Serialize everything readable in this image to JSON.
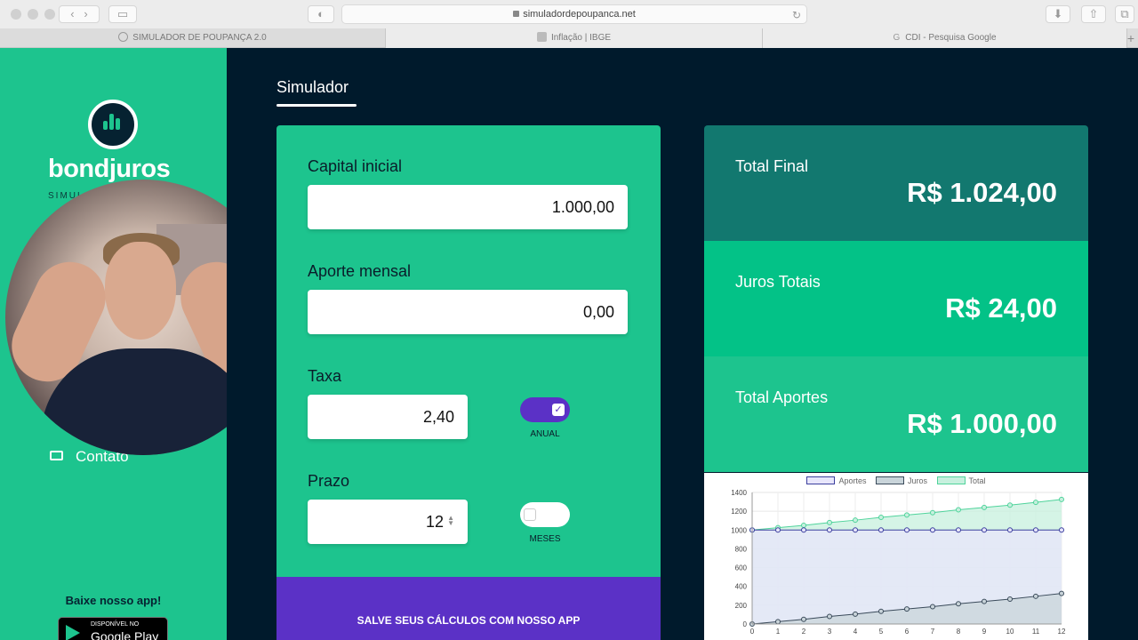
{
  "browser": {
    "url": "simuladordepoupanca.net",
    "tabs": [
      {
        "label": "SIMULADOR DE POUPANÇA 2.0"
      },
      {
        "label": "Inflação | IBGE"
      },
      {
        "label": "CDI - Pesquisa Google"
      }
    ]
  },
  "sidebar": {
    "brand": "bondjuros",
    "brand_sub": "SIMUL",
    "contact_label": "Contato",
    "app_promo": "Baixe nosso app!",
    "gplay_small": "DISPONÍVEL NO",
    "gplay_big": "Google Play"
  },
  "main": {
    "page_tab": "Simulador",
    "fields": {
      "capital": {
        "label": "Capital inicial",
        "value": "1.000,00"
      },
      "aporte": {
        "label": "Aporte mensal",
        "value": "0,00"
      },
      "taxa": {
        "label": "Taxa",
        "value": "2,40",
        "toggle_label": "ANUAL"
      },
      "prazo": {
        "label": "Prazo",
        "value": "12",
        "toggle_label": "MESES"
      }
    },
    "save_label": "SALVE SEUS CÁLCULOS COM NOSSO APP"
  },
  "results": {
    "total_final": {
      "label": "Total Final",
      "value": "R$ 1.024,00"
    },
    "juros_totais": {
      "label": "Juros Totais",
      "value": "R$ 24,00"
    },
    "total_aportes": {
      "label": "Total Aportes",
      "value": "R$ 1.000,00"
    }
  },
  "chart_data": {
    "type": "area",
    "x": [
      0,
      1,
      2,
      3,
      4,
      5,
      6,
      7,
      8,
      9,
      10,
      11,
      12
    ],
    "ylim": [
      0,
      1400
    ],
    "yticks": [
      0,
      200,
      400,
      600,
      800,
      1000,
      1200,
      1400
    ],
    "grid": true,
    "legend_position": "top",
    "series": [
      {
        "name": "Aportes",
        "color": "#3b3f9e",
        "fill": "#e8e6fb",
        "values": [
          1000,
          1000,
          1000,
          1000,
          1000,
          1000,
          1000,
          1000,
          1000,
          1000,
          1000,
          1000,
          1000
        ]
      },
      {
        "name": "Juros",
        "color": "#3a4a5a",
        "fill": "#c9d4da",
        "values": [
          0,
          25,
          50,
          80,
          105,
          135,
          160,
          185,
          215,
          240,
          265,
          295,
          325
        ]
      },
      {
        "name": "Total",
        "color": "#4fd39b",
        "fill": "#c7f0de",
        "values": [
          1000,
          1025,
          1050,
          1080,
          1105,
          1135,
          1160,
          1185,
          1215,
          1240,
          1265,
          1295,
          1325
        ]
      }
    ]
  }
}
